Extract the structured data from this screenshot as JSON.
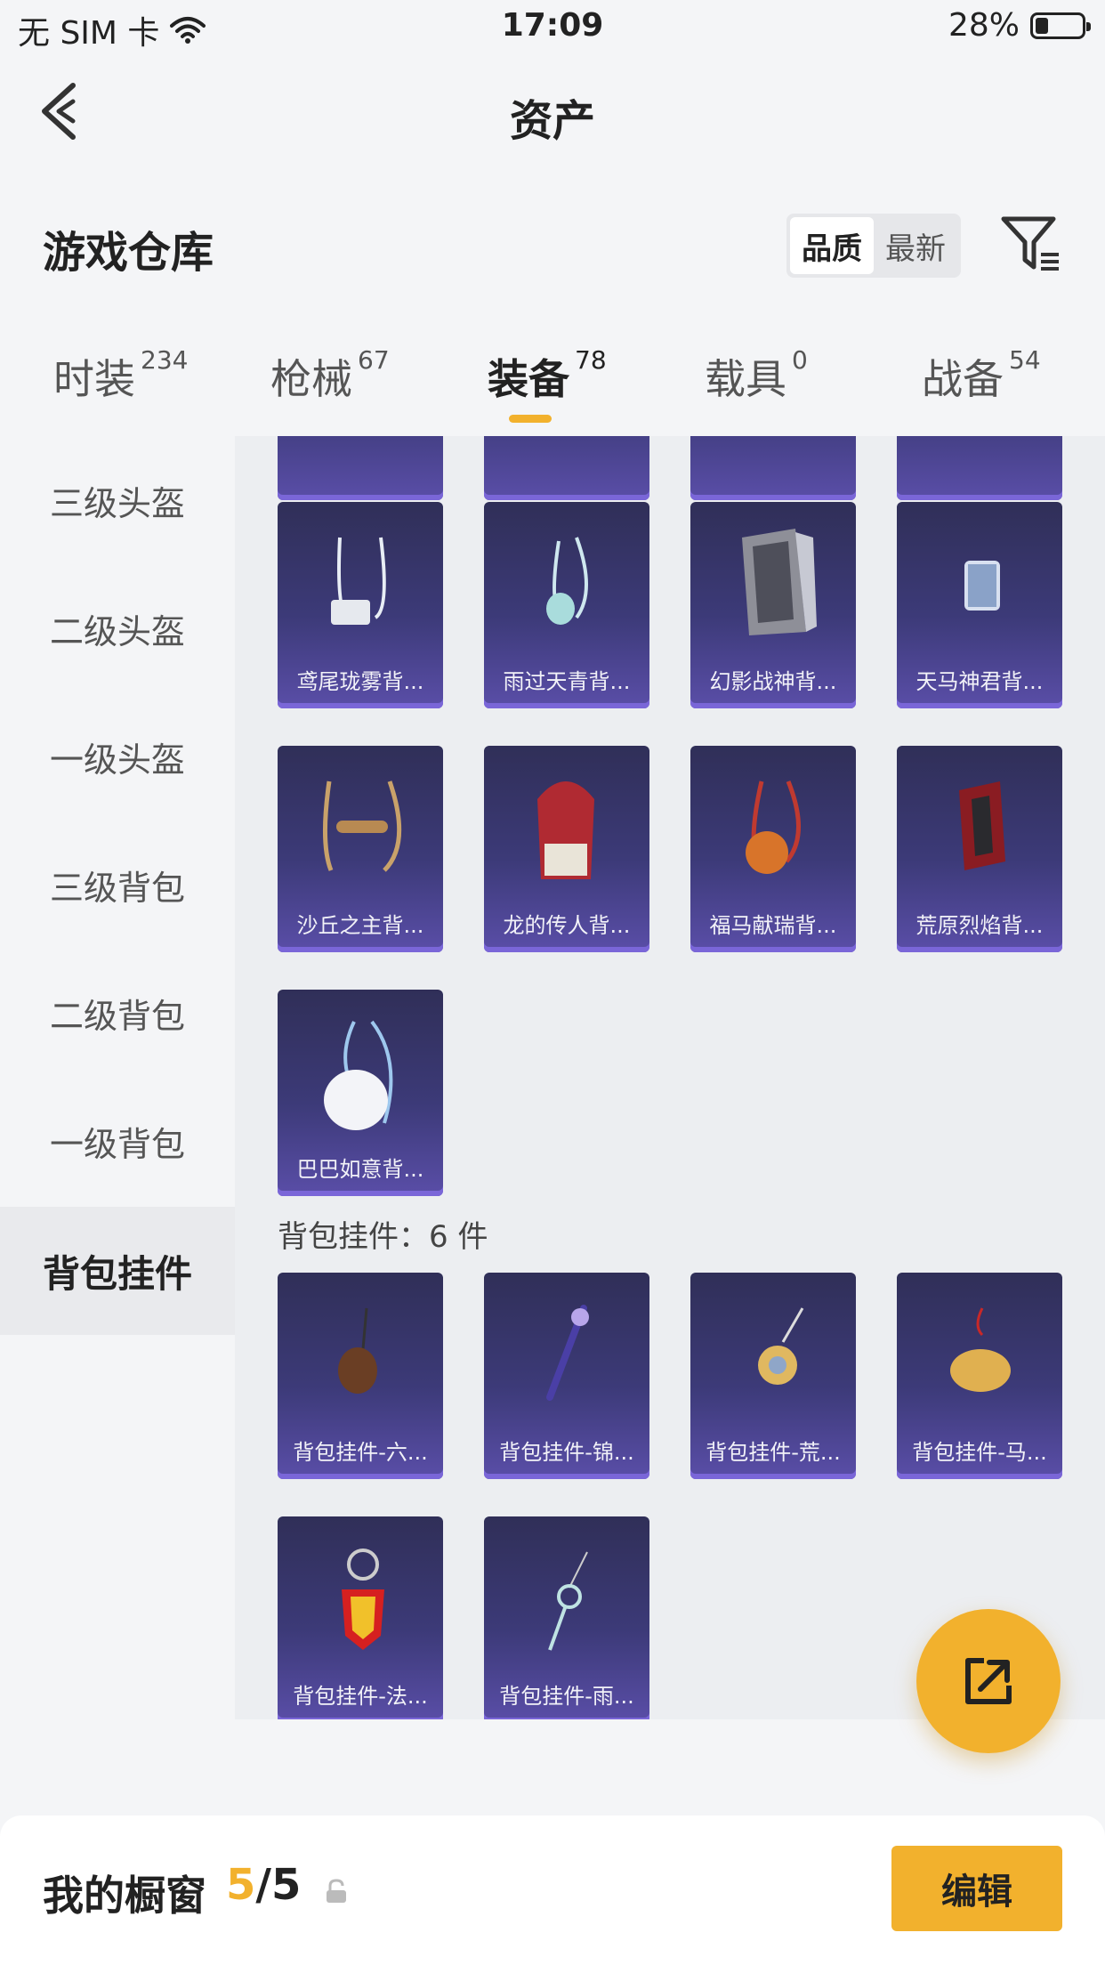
{
  "status_bar": {
    "carrier": "无 SIM 卡",
    "time": "17:09",
    "battery": "28%"
  },
  "nav": {
    "title": "资产"
  },
  "header": {
    "title": "游戏仓库",
    "sort": {
      "quality": "品质",
      "latest": "最新"
    }
  },
  "tabs": [
    {
      "label": "时装",
      "count": "234"
    },
    {
      "label": "枪械",
      "count": "67"
    },
    {
      "label": "装备",
      "count": "78"
    },
    {
      "label": "载具",
      "count": "0"
    },
    {
      "label": "战备",
      "count": "54"
    }
  ],
  "sidebar": [
    "三级头盔",
    "二级头盔",
    "一级头盔",
    "三级背包",
    "二级背包",
    "一级背包",
    "背包挂件"
  ],
  "backpacks": [
    "鸢尾珑雾背...",
    "雨过天青背...",
    "幻影战神背...",
    "天马神君背...",
    "沙丘之主背...",
    "龙的传人背...",
    "福马献瑞背...",
    "荒原烈焰背...",
    "巴巴如意背..."
  ],
  "pendant_header": "背包挂件：6 件",
  "pendants": [
    "背包挂件-六...",
    "背包挂件-锦...",
    "背包挂件-荒...",
    "背包挂件-马...",
    "背包挂件-法...",
    "背包挂件-雨..."
  ],
  "bottom": {
    "showcase": "我的橱窗",
    "used": "5",
    "total": "/5",
    "edit": "编辑"
  },
  "colors": {
    "accent": "#f2b12d",
    "card": "#3c3a78"
  }
}
